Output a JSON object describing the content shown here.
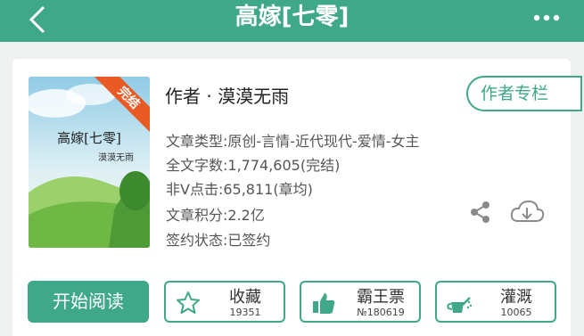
{
  "header": {
    "title": "高嫁[七零]"
  },
  "book": {
    "cover_title": "高嫁[七零]",
    "cover_author": "漠漠无雨",
    "cover_badge": "完结",
    "author_line": "作者 · 漠漠无雨",
    "author_column_label": "作者专栏",
    "type": "文章类型:原创-言情-近代现代-爱情-女主",
    "word_count": "全文字数:1,774,605(完结)",
    "clicks": "非V点击:65,811(章均)",
    "score": "文章积分:2.2亿",
    "contract": "签约状态:已签约"
  },
  "actions": {
    "start_reading": "开始阅读",
    "collect": {
      "label": "收藏",
      "count": "19351"
    },
    "vote": {
      "label": "霸王票",
      "count": "№180619"
    },
    "water": {
      "label": "灌溉",
      "count": "10065"
    }
  },
  "colors": {
    "accent": "#3ea889",
    "badge": "#e95a25"
  }
}
